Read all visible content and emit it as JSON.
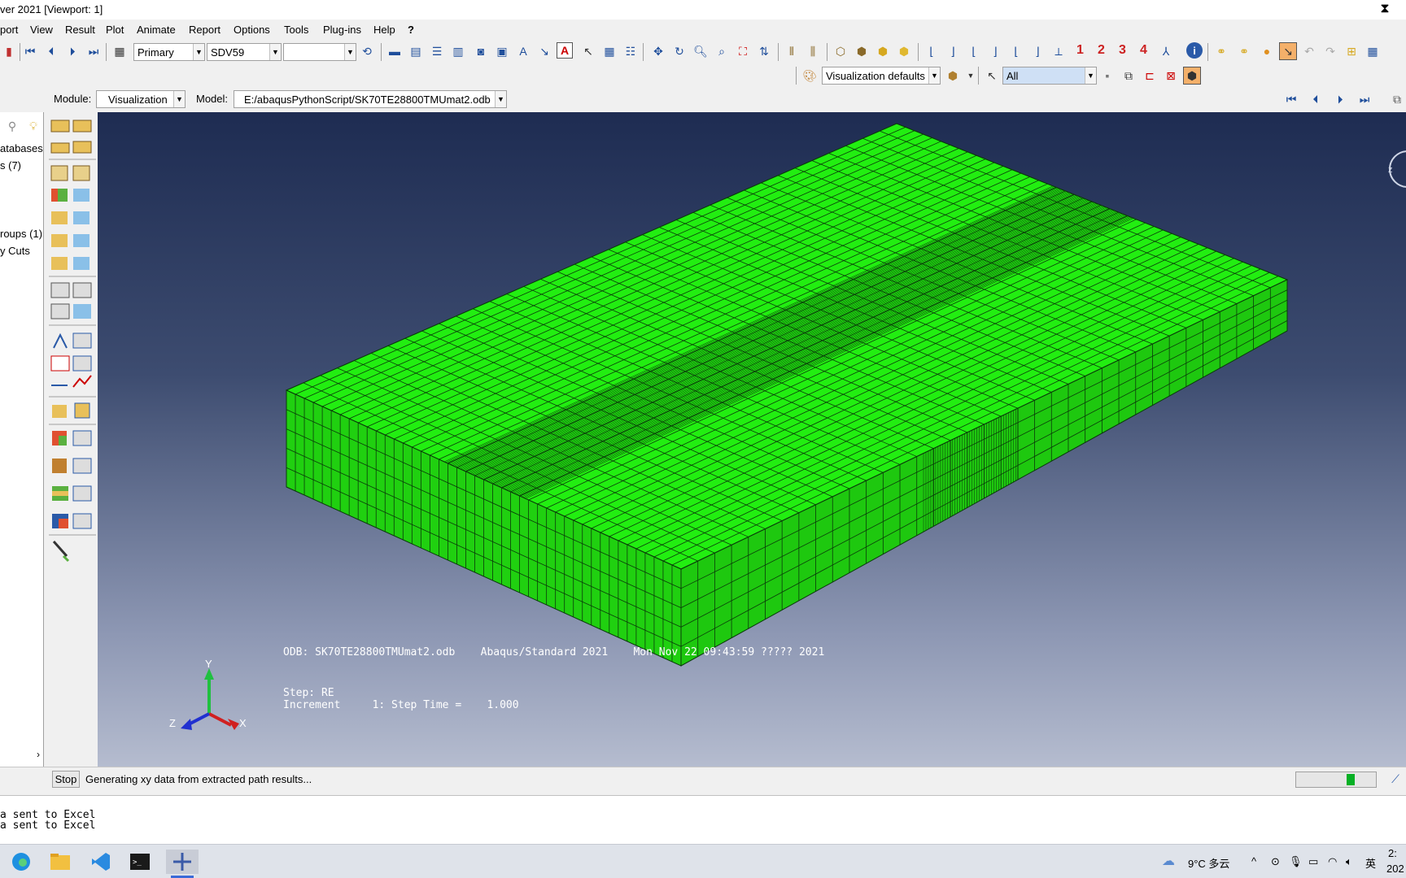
{
  "window": {
    "title": "ver 2021 [Viewport: 1]"
  },
  "menu": [
    {
      "label": "port",
      "ul": ""
    },
    {
      "label": "View",
      "ul": "V"
    },
    {
      "label": "Result",
      "ul": "R"
    },
    {
      "label": "Plot",
      "ul": "P"
    },
    {
      "label": "Animate",
      "ul": "A"
    },
    {
      "label": "Report",
      "ul": "R"
    },
    {
      "label": "Options",
      "ul": "O"
    },
    {
      "label": "Tools",
      "ul": "T"
    },
    {
      "label": "Plug-ins",
      "ul": "g"
    },
    {
      "label": "Help",
      "ul": "H"
    },
    {
      "label": "?",
      "ul": ""
    }
  ],
  "toolbar": {
    "field_type": "Primary",
    "variable": "SDV59",
    "component": "",
    "view_numbers": [
      "1",
      "2",
      "3",
      "4"
    ],
    "vis_defaults": "Visualization defaults",
    "selection_filter": "All"
  },
  "module_bar": {
    "module_label": "Module:",
    "module_value": "Visualization",
    "model_label": "Model:",
    "model_value": "E:/abaqusPythonScript/SK70TE28800TMUmat2.odb"
  },
  "tree": {
    "items": [
      "atabases",
      "s (7)",
      "roups (1)",
      "y Cuts"
    ]
  },
  "viewport": {
    "odb_line": "ODB: SK70TE28800TMUmat2.odb    Abaqus/Standard 2021    Mon Nov 22 09:43:59 ????? 2021",
    "step_line": "Step: RE",
    "increment_line": "Increment     1: Step Time =    1.000",
    "triad": {
      "x": "X",
      "y": "Y",
      "z": "Z"
    },
    "mesh_color": "#22ee11"
  },
  "status": {
    "stop_label": "Stop",
    "message": "Generating xy data from extracted path results...",
    "progress_fraction": 0.1
  },
  "messages": [
    "a sent to Excel",
    "a sent to Excel"
  ],
  "taskbar": {
    "weather": "9°C 多云",
    "ime": "英",
    "clock_line1": "2:",
    "clock_line2": "202"
  }
}
